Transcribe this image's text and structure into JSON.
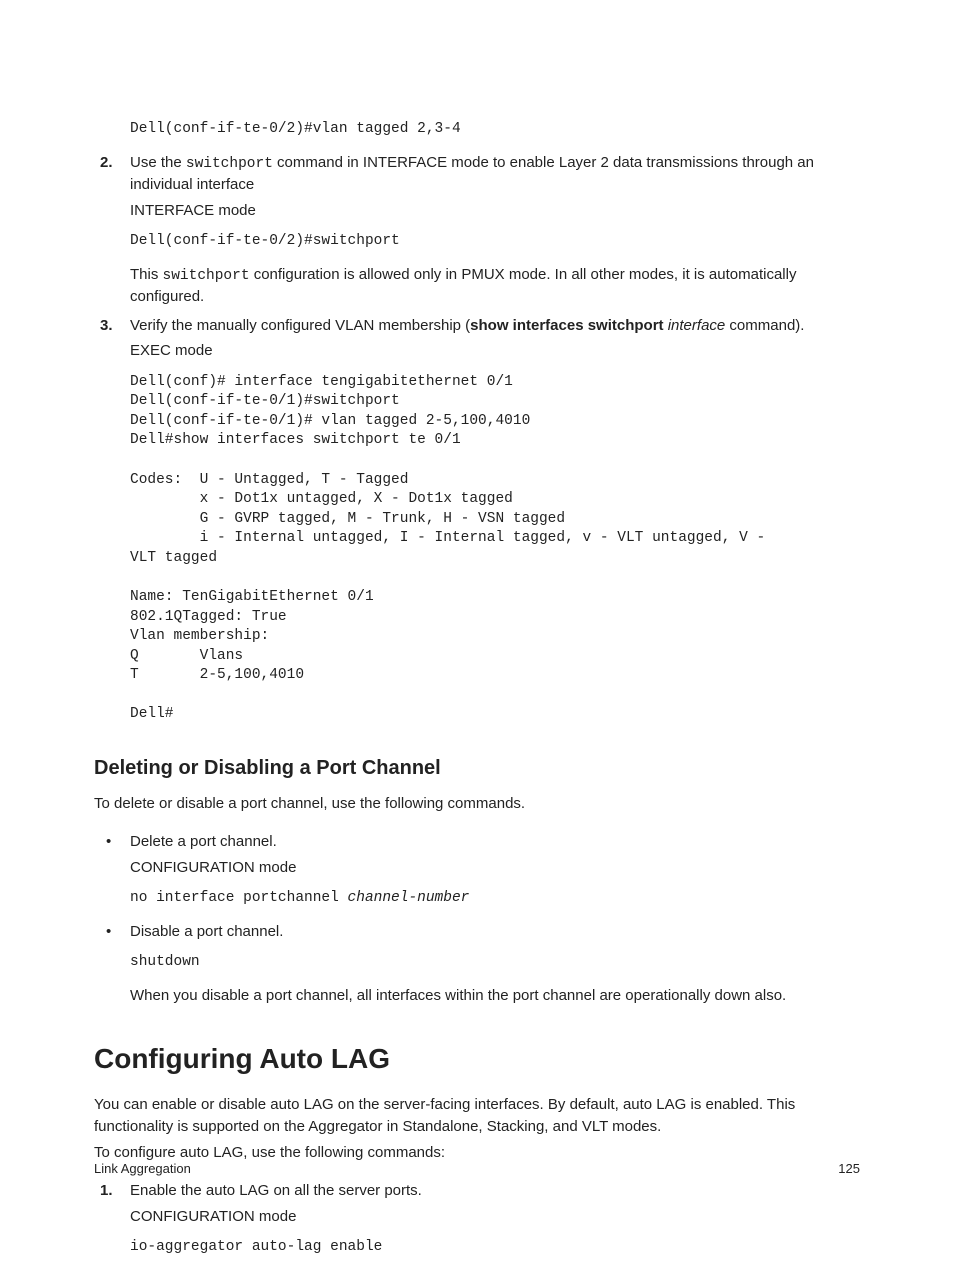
{
  "code_top": "Dell(conf-if-te-0/2)#vlan tagged 2,3-4",
  "step2": {
    "num": "2.",
    "text_before": "Use the ",
    "code_inline": "switchport",
    "text_after": " command in INTERFACE mode to enable Layer 2 data transmissions through an individual interface",
    "mode": "INTERFACE mode",
    "code": "Dell(conf-if-te-0/2)#switchport",
    "note_before": "This ",
    "note_code": "switchport",
    "note_after": " configuration is allowed only in PMUX mode. In all other modes, it is automatically configured."
  },
  "step3": {
    "num": "3.",
    "text_before": "Verify the manually configured VLAN membership (",
    "bold_cmd": "show interfaces switchport",
    "italic_arg": "interface",
    "text_after": " command).",
    "mode": "EXEC mode",
    "code": "Dell(conf)# interface tengigabitethernet 0/1\nDell(conf-if-te-0/1)#switchport\nDell(conf-if-te-0/1)# vlan tagged 2-5,100,4010\nDell#show interfaces switchport te 0/1\n\nCodes:  U - Untagged, T - Tagged\n        x - Dot1x untagged, X - Dot1x tagged\n        G - GVRP tagged, M - Trunk, H - VSN tagged\n        i - Internal untagged, I - Internal tagged, v - VLT untagged, V - \nVLT tagged\n\nName: TenGigabitEthernet 0/1\n802.1QTagged: True\nVlan membership:\nQ       Vlans\nT       2-5,100,4010\n\nDell#"
  },
  "section_delete": {
    "title": "Deleting or Disabling a Port Channel",
    "intro": "To delete or disable a port channel, use the following commands.",
    "bullet1": {
      "text": "Delete a port channel.",
      "mode": "CONFIGURATION mode",
      "code_plain": "no interface portchannel ",
      "code_italic": "channel-number"
    },
    "bullet2": {
      "text": "Disable a port channel.",
      "code": "shutdown",
      "note": "When you disable a port channel, all interfaces within the port channel are operationally down also."
    }
  },
  "section_autolag": {
    "title": "Configuring Auto LAG",
    "intro1": "You can enable or disable auto LAG on the server-facing interfaces. By default, auto LAG is enabled. This functionality is supported on the Aggregator in Standalone, Stacking, and VLT modes.",
    "intro2": "To configure auto LAG, use the following commands:",
    "step1": {
      "num": "1.",
      "text": "Enable the auto LAG on all the server ports.",
      "mode": "CONFIGURATION mode",
      "code": "io-aggregator auto-lag enable"
    }
  },
  "footer": {
    "left": "Link Aggregation",
    "right": "125"
  }
}
